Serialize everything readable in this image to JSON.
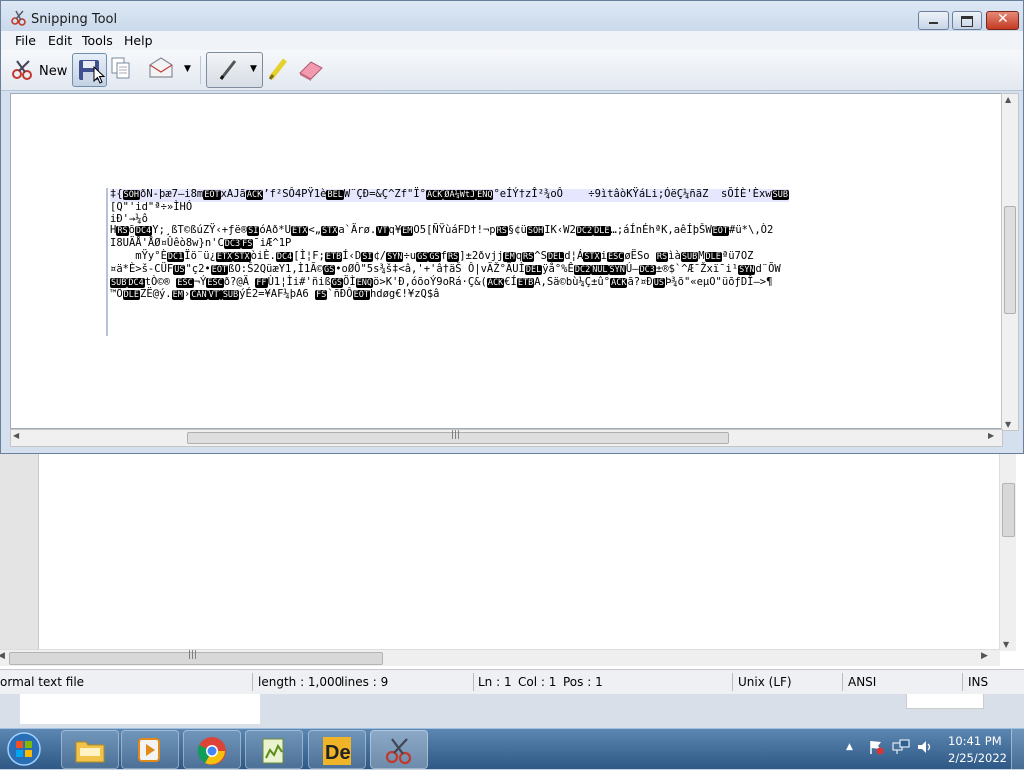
{
  "window": {
    "title": "Snipping Tool"
  },
  "menu": [
    "File",
    "Edit",
    "Tools",
    "Help"
  ],
  "toolbar": {
    "new_label": "New"
  },
  "snip_lines": [
    [
      "‡{",
      "@SOH",
      "ðN-þæ7—i8m",
      "@EOT",
      "xAJã",
      "@ACK",
      "’f²SÔ4PŸ1è",
      "@BEL",
      "W¨ÇÐ=&Ç^Zf\"Ï°",
      "@ACK",
      "@ØA¼WtJ",
      "@ENQ",
      "°eÍÝ†zÎ²¾oÔ    ÷9ìtâòKŸáLi;ÓëÇ¼ñãZ  sÕÍÈ'Èxw",
      "@SUB"
    ],
    [
      "[Q\"'id\"ª÷»ÌHÓ"
    ],
    [
      "iÐ'→¼ô"
    ],
    [
      "H",
      "@RS",
      "õ",
      "@DC4",
      "Y;¸ßT©ßúZŸ‹+ƒë®",
      "@SI",
      "óAð*U",
      "@ETX",
      "<„",
      "@STX",
      "a`Ärø.",
      "@VT",
      "q¥",
      "@EM",
      "O5[ÑŸùáFD†!¬p",
      "@RS",
      "§¢ü",
      "@SOH",
      "IK‹W2",
      "@DC2",
      "@DLE",
      "…;áÍnÉhªK,aêÍþŠW",
      "@EOT",
      "#ü*\\,Ò2"
    ],
    [
      "I8UÄÅ'ÅØ¤Ûêò8w}n'C",
      "@DC3",
      "@FS",
      "¯iÆ^1P"
    ],
    [
      "    mŸy°È",
      "@DC1",
      "Ïö¨ü¿",
      "@ETX",
      "@STX",
      "òiÈ.",
      "@DC4",
      "[Ì¦F;",
      "@ETB",
      "Í‹D",
      "@SI",
      "¢/",
      "@SYN",
      "÷u",
      "@GS",
      "@GS",
      "f",
      "@RS",
      "]±2ðvjj",
      "@EM",
      "q",
      "@RS",
      "^S",
      "@DEL",
      "d¦Á",
      "@STX",
      "i",
      "@ESC",
      "øËSo ",
      "@RS",
      "ìà",
      "@SUB",
      "M",
      "@DLE",
      "ªü7OZ"
    ],
    [
      "¤ä*È>š-CÜF",
      "@US",
      "\"ç2•",
      "@EOT",
      "ßO:Š2QüæY1,Ì1Ã©",
      "@GS",
      "•oØÔ\"5s¾š‡<â,'+'â†äŠ Ô|vÃŽ°ÄUÌ",
      "@DEL",
      "ÿå°%Ê",
      "@DC2",
      "@NUL",
      "@SYN",
      "Ú—",
      "@DC3",
      "±®$`^Æ¯Žxï¯i¹",
      "@SYN",
      "d¨ÕW"
    ],
    [
      "@SUB",
      "@DC4",
      "tÒ©® ",
      "@ESC",
      "¬Ý",
      "@ESC",
      "ð?@Ä ",
      "@FF",
      "Ù1¦Ìi#'ñiß",
      "@GS",
      "ÖÌ",
      "@ENQ",
      "ö>K'Ð,óõoÝ9oRá·Ç&(",
      "@ACK",
      "€Í",
      "@ETB",
      "A,Sä©bù¼Ç±û°",
      "@ACK",
      "ã?¤Ð",
      "@US",
      "Þ¾õ\"«eµO\"üõƒDÎ—>¶"
    ],
    [
      "™Ô",
      "@DLE",
      "ZË@ý.",
      "@EM",
      "›",
      "@CAN",
      "@VT",
      "@",
      "@SUB",
      "ýÉ2=¥AF¼þA6 ",
      "@FS",
      "`ñÐÔ",
      "@EOT",
      "hdøg€!¥zQ$â"
    ]
  ],
  "status": {
    "file_type": "ormal text file",
    "length": "length : 1,000",
    "lines": "lines : 9",
    "ln": "Ln : 1",
    "col": "Col : 1",
    "pos": "Pos : 1",
    "eol": "Unix (LF)",
    "enc": "ANSI",
    "mode": "INS"
  },
  "bg_tail_text": "...",
  "taskbar": {
    "apps": [
      "file-explorer",
      "media-player",
      "chrome",
      "notepad-plus-plus",
      "de-app",
      "snipping-tool"
    ]
  },
  "clock": {
    "time": "10:41 PM",
    "date": "2/25/2022"
  }
}
